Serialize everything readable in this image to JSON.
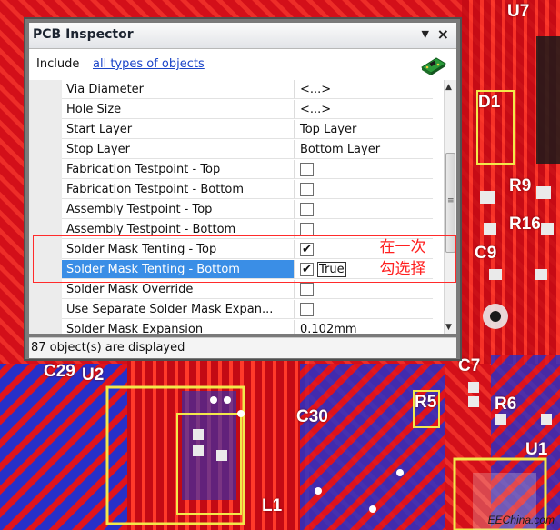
{
  "window": {
    "title": "PCB Inspector",
    "include_label": "Include",
    "include_link": "all types of objects"
  },
  "properties": [
    {
      "name": "Via Diameter",
      "value": "<...>"
    },
    {
      "name": "Hole Size",
      "value": "<...>"
    },
    {
      "name": "Start Layer",
      "value": "Top Layer"
    },
    {
      "name": "Stop Layer",
      "value": "Bottom Layer"
    },
    {
      "name": "Fabrication Testpoint - Top",
      "checkbox": false
    },
    {
      "name": "Fabrication Testpoint - Bottom",
      "checkbox": false
    },
    {
      "name": "Assembly Testpoint - Top",
      "checkbox": false
    },
    {
      "name": "Assembly Testpoint - Bottom",
      "checkbox": false
    },
    {
      "name": "Solder Mask Tenting - Top",
      "checkbox": true
    },
    {
      "name": "Solder Mask Tenting - Bottom",
      "checkbox": true,
      "selected": true,
      "value_text": "True"
    },
    {
      "name": "Solder Mask Override",
      "checkbox": false
    },
    {
      "name": "Use Separate Solder Mask Expan...",
      "checkbox": false
    },
    {
      "name": "Solder Mask Expansion",
      "value": "0.102mm"
    }
  ],
  "status_text": "87 object(s) are displayed",
  "annotation": {
    "line1": "在一次",
    "line2": "勾选择",
    "color": "#ff2020"
  },
  "pcb_labels": {
    "u7": "U7",
    "d1": "D1",
    "r9": "R9",
    "r16": "R16",
    "c9": "C9",
    "c29": "C29",
    "u2": "U2",
    "c7": "C7",
    "r5": "R5",
    "r6": "R6",
    "c30": "C30",
    "u1": "U1",
    "l1": "L1"
  },
  "brand": "EEChina.com",
  "colors": {
    "board": "#d8101a",
    "trace": "#ff3a2a",
    "bottom_layer": "#1f2cc8",
    "silkscreen": "#f2e94a",
    "selection": "#3a8ee6"
  }
}
